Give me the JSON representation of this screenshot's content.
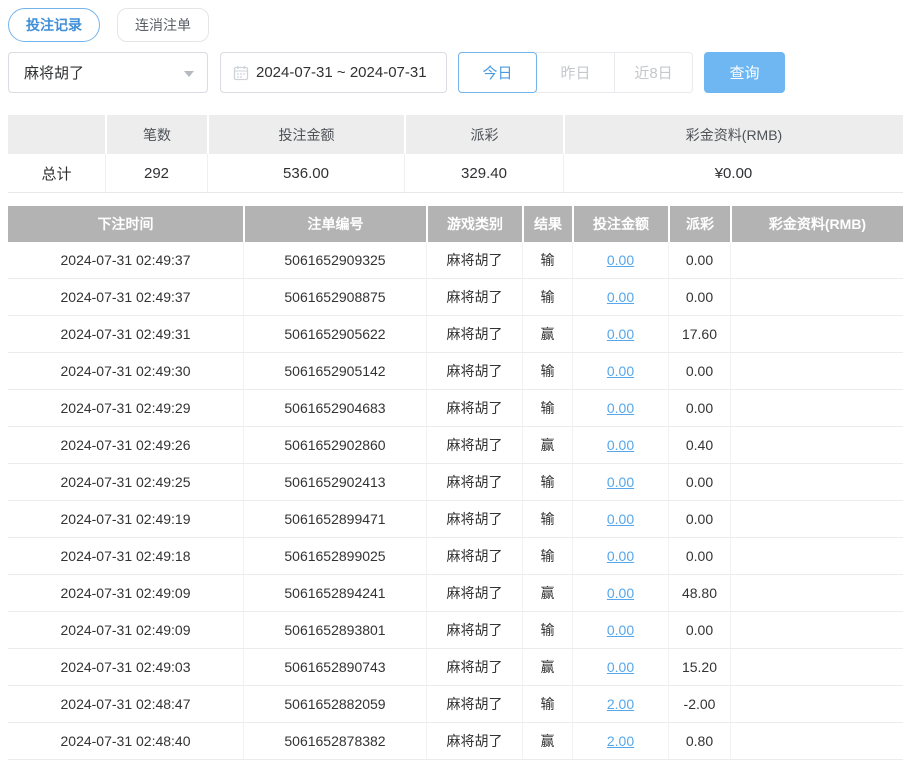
{
  "colors": {
    "primary_text": "#3e8fd8",
    "primary_border": "#74b4ec",
    "query_button_bg": "#6fb7f2",
    "link_blue": "#57a7ea",
    "negative_red": "#e45656",
    "table_header_bg": "#b3b3b3",
    "summary_header_bg": "#ededed"
  },
  "icons": {
    "calendar": "calendar-icon",
    "select_caret": "chevron-down-icon"
  },
  "tabs": [
    {
      "label": "投注记录",
      "active": true
    },
    {
      "label": "连消注单",
      "active": false
    }
  ],
  "filters": {
    "game_select": {
      "value": "麻将胡了"
    },
    "date_range": {
      "value": "2024-07-31 ~ 2024-07-31"
    },
    "quick_ranges": [
      {
        "label": "今日",
        "active": true
      },
      {
        "label": "昨日",
        "active": false
      },
      {
        "label": "近8日",
        "active": false
      }
    ],
    "query_label": "查询"
  },
  "summary": {
    "headers": [
      "",
      "笔数",
      "投注金额",
      "派彩",
      "彩金资料(RMB)"
    ],
    "row": {
      "label": "总计",
      "count": "292",
      "bet_amount": "536.00",
      "payout": "329.40",
      "jackpot": "¥0.00"
    }
  },
  "table": {
    "headers": [
      "下注时间",
      "注单编号",
      "游戏类别",
      "结果",
      "投注金额",
      "派彩",
      "彩金资料(RMB)"
    ],
    "rows": [
      [
        "2024-07-31 02:49:37",
        "5061652909325",
        "麻将胡了",
        "输",
        "0.00",
        "0.00",
        ""
      ],
      [
        "2024-07-31 02:49:37",
        "5061652908875",
        "麻将胡了",
        "输",
        "0.00",
        "0.00",
        ""
      ],
      [
        "2024-07-31 02:49:31",
        "5061652905622",
        "麻将胡了",
        "赢",
        "0.00",
        "17.60",
        ""
      ],
      [
        "2024-07-31 02:49:30",
        "5061652905142",
        "麻将胡了",
        "输",
        "0.00",
        "0.00",
        ""
      ],
      [
        "2024-07-31 02:49:29",
        "5061652904683",
        "麻将胡了",
        "输",
        "0.00",
        "0.00",
        ""
      ],
      [
        "2024-07-31 02:49:26",
        "5061652902860",
        "麻将胡了",
        "赢",
        "0.00",
        "0.40",
        ""
      ],
      [
        "2024-07-31 02:49:25",
        "5061652902413",
        "麻将胡了",
        "输",
        "0.00",
        "0.00",
        ""
      ],
      [
        "2024-07-31 02:49:19",
        "5061652899471",
        "麻将胡了",
        "输",
        "0.00",
        "0.00",
        ""
      ],
      [
        "2024-07-31 02:49:18",
        "5061652899025",
        "麻将胡了",
        "输",
        "0.00",
        "0.00",
        ""
      ],
      [
        "2024-07-31 02:49:09",
        "5061652894241",
        "麻将胡了",
        "赢",
        "0.00",
        "48.80",
        ""
      ],
      [
        "2024-07-31 02:49:09",
        "5061652893801",
        "麻将胡了",
        "输",
        "0.00",
        "0.00",
        ""
      ],
      [
        "2024-07-31 02:49:03",
        "5061652890743",
        "麻将胡了",
        "赢",
        "0.00",
        "15.20",
        ""
      ],
      [
        "2024-07-31 02:48:47",
        "5061652882059",
        "麻将胡了",
        "输",
        "2.00",
        "-2.00",
        ""
      ],
      [
        "2024-07-31 02:48:40",
        "5061652878382",
        "麻将胡了",
        "赢",
        "2.00",
        "0.80",
        ""
      ]
    ]
  }
}
